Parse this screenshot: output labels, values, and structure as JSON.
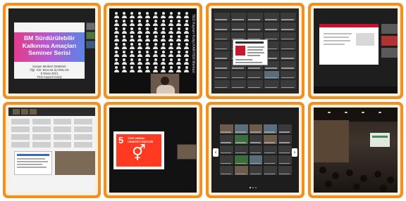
{
  "collage": {
    "label": "Seminar screenshots collage"
  },
  "tile1": {
    "title_line1": "BM Sürdürülebilir",
    "title_line2": "Kalkınma Amaçları",
    "title_line3": "Seminer Serisi",
    "sub_line1": "Kariyer Merkezi Direktörü",
    "sub_line2": "Öğr. Gör. Esra KILIÇARSLAN",
    "sub_line3": "8 Nisan 2021",
    "sub_line4": "TED Kayseri Koleji"
  },
  "tile2": {
    "vertical_text": "TED Kayseri Koleji KARİYER Merkezi"
  },
  "tile6": {
    "sdg_number": "5",
    "sdg_label_line1": "TOPLUMSAL",
    "sdg_label_line2": "CİNSİYET EŞİTLİĞİ",
    "sdg_symbol": "⚥"
  },
  "tile7": {
    "arrow_left": "‹",
    "arrow_right": "›"
  },
  "colors": {
    "frame": "#f2901f",
    "sdg5": "#ff3a21",
    "sdg3": "#c5192d"
  }
}
